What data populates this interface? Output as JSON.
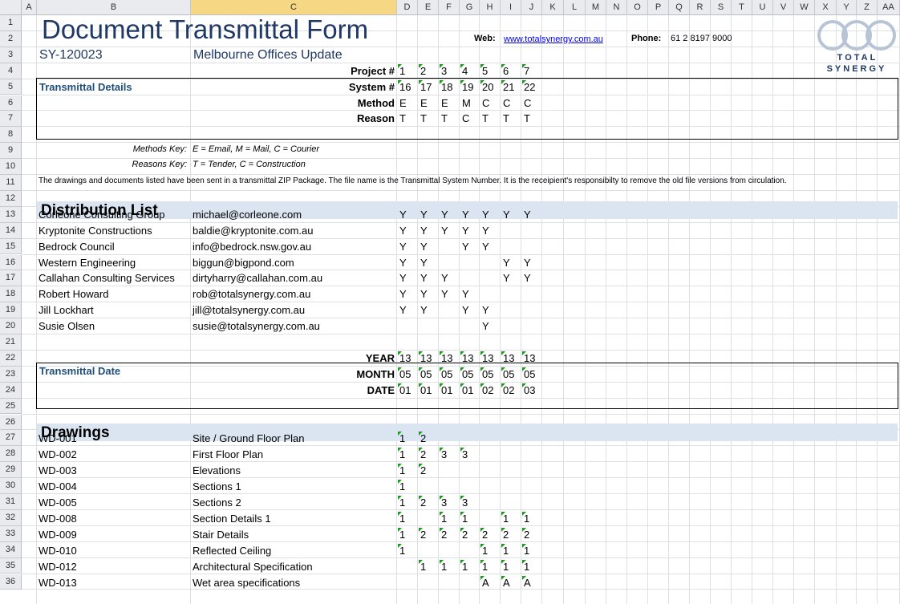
{
  "columns": [
    "A",
    "B",
    "C",
    "D",
    "E",
    "F",
    "G",
    "H",
    "I",
    "J",
    "K",
    "L",
    "M",
    "N",
    "O",
    "P",
    "Q",
    "R",
    "S",
    "T",
    "U",
    "V",
    "W",
    "X",
    "Y",
    "Z",
    "AA"
  ],
  "rows": [
    "1",
    "2",
    "3",
    "4",
    "5",
    "6",
    "7",
    "8",
    "9",
    "10",
    "11",
    "12",
    "13",
    "14",
    "15",
    "16",
    "17",
    "18",
    "19",
    "20",
    "21",
    "22",
    "23",
    "24",
    "25",
    "26",
    "27",
    "28",
    "29",
    "30",
    "31",
    "32",
    "33",
    "34",
    "35",
    "36"
  ],
  "header": {
    "title": "Document Transmittal Form",
    "doc_number": "SY-120023",
    "project_name": "Melbourne Offices Update",
    "web_label": "Web:",
    "web_url": "www.totalsynergy.com.au",
    "phone_label": "Phone:",
    "phone_value": "61 2 8197 9000",
    "logo_line1": "TOTAL",
    "logo_line2": "SYNERGY"
  },
  "details": {
    "section_label": "Transmittal Details",
    "labels": [
      "Project #",
      "System #",
      "Method",
      "Reason"
    ],
    "values": [
      [
        "1",
        "2",
        "3",
        "4",
        "5",
        "6",
        "7"
      ],
      [
        "16",
        "17",
        "18",
        "19",
        "20",
        "21",
        "22"
      ],
      [
        "E",
        "E",
        "E",
        "M",
        "C",
        "C",
        "C"
      ],
      [
        "T",
        "T",
        "T",
        "C",
        "T",
        "T",
        "T"
      ]
    ],
    "methods_key_label": "Methods Key:",
    "methods_key_value": "E = Email, M = Mail, C = Courier",
    "reasons_key_label": "Reasons Key:",
    "reasons_key_value": "T = Tender, C = Construction",
    "note": "The drawings and documents listed have been sent in a transmittal ZIP Package. The file name is the Transmittal System Number. It is the receipient's responsibilty to remove the old file versions from circulation."
  },
  "distribution": {
    "title": "Distribution List",
    "rows": [
      {
        "name": "Corleone Consulting Group",
        "email": "michael@corleone.com",
        "marks": [
          "Y",
          "Y",
          "Y",
          "Y",
          "Y",
          "Y",
          "Y"
        ]
      },
      {
        "name": "Kryptonite Constructions",
        "email": "baldie@kryptonite.com.au",
        "marks": [
          "Y",
          "Y",
          "Y",
          "Y",
          "Y",
          "",
          ""
        ]
      },
      {
        "name": "Bedrock Council",
        "email": "info@bedrock.nsw.gov.au",
        "marks": [
          "Y",
          "Y",
          "",
          "Y",
          "Y",
          "",
          ""
        ]
      },
      {
        "name": "Western Engineering",
        "email": "biggun@bigpond.com",
        "marks": [
          "Y",
          "Y",
          "",
          "",
          "",
          "Y",
          "Y"
        ]
      },
      {
        "name": "Callahan Consulting Services",
        "email": "dirtyharry@callahan.com.au",
        "marks": [
          "Y",
          "Y",
          "Y",
          "",
          "",
          "Y",
          "Y"
        ]
      },
      {
        "name": "Robert Howard",
        "email": "rob@totalsynergy.com.au",
        "marks": [
          "Y",
          "Y",
          "Y",
          "Y",
          "",
          "",
          ""
        ]
      },
      {
        "name": "Jill Lockhart",
        "email": "jill@totalsynergy.com.au",
        "marks": [
          "Y",
          "Y",
          "",
          "Y",
          "Y",
          "",
          ""
        ]
      },
      {
        "name": "Susie Olsen",
        "email": "susie@totalsynergy.com.au",
        "marks": [
          "",
          "",
          "",
          "",
          "Y",
          "",
          ""
        ]
      }
    ]
  },
  "dates": {
    "section_label": "Transmittal Date",
    "labels": [
      "YEAR",
      "MONTH",
      "DATE"
    ],
    "values": [
      [
        "13",
        "13",
        "13",
        "13",
        "13",
        "13",
        "13"
      ],
      [
        "05",
        "05",
        "05",
        "05",
        "05",
        "05",
        "05"
      ],
      [
        "01",
        "01",
        "01",
        "01",
        "02",
        "02",
        "03"
      ]
    ]
  },
  "drawings": {
    "title": "Drawings",
    "rows": [
      {
        "id": "WD-001",
        "name": "Site / Ground Floor Plan",
        "revs": [
          "1",
          "2",
          "",
          "",
          "",
          "",
          ""
        ]
      },
      {
        "id": "WD-002",
        "name": "First Floor Plan",
        "revs": [
          "1",
          "2",
          "3",
          "3",
          "",
          "",
          ""
        ]
      },
      {
        "id": "WD-003",
        "name": "Elevations",
        "revs": [
          "1",
          "2",
          "",
          "",
          "",
          "",
          ""
        ]
      },
      {
        "id": "WD-004",
        "name": "Sections 1",
        "revs": [
          "1",
          "",
          "",
          "",
          "",
          "",
          ""
        ]
      },
      {
        "id": "WD-005",
        "name": "Sections 2",
        "revs": [
          "1",
          "2",
          "3",
          "3",
          "",
          "",
          ""
        ]
      },
      {
        "id": "WD-008",
        "name": "Section Details 1",
        "revs": [
          "1",
          "",
          "1",
          "1",
          "",
          "1",
          "1"
        ]
      },
      {
        "id": "WD-009",
        "name": "Stair Details",
        "revs": [
          "1",
          "2",
          "2",
          "2",
          "2",
          "2",
          "2"
        ]
      },
      {
        "id": "WD-010",
        "name": "Reflected Ceiling",
        "revs": [
          "1",
          "",
          "",
          "",
          "1",
          "1",
          "1"
        ]
      },
      {
        "id": "WD-012",
        "name": "Architectural Specification",
        "revs": [
          "",
          "1",
          "1",
          "1",
          "1",
          "1",
          "1"
        ]
      },
      {
        "id": "WD-013",
        "name": "Wet area specifications",
        "revs": [
          "",
          "",
          "",
          "",
          "A",
          "A",
          "A"
        ]
      }
    ]
  }
}
